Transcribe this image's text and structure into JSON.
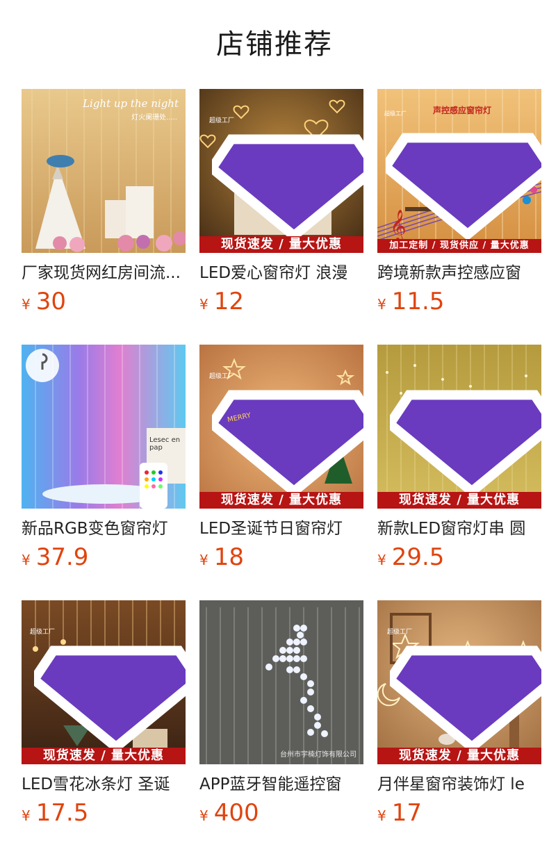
{
  "header": {
    "title": "店铺推荐"
  },
  "colors": {
    "price": "#e0440e",
    "banner": "#b71414"
  },
  "products": [
    {
      "name": "厂家现货网红房间流...",
      "currency": "¥",
      "price": "30",
      "banner": "",
      "overlay": "Light up the night",
      "overlay_sub": "灯火阑珊处....."
    },
    {
      "name": "LED爱心窗帘灯 浪漫",
      "currency": "¥",
      "price": "12",
      "banner": "现货速发 / 量大优惠",
      "badge_text": "超级工厂"
    },
    {
      "name": "跨境新款声控感应窗",
      "currency": "¥",
      "price": "11.5",
      "banner": "加工定制 / 现货供应 / 量大优惠",
      "badge_text": "超级工厂",
      "top_text": "声控感应窗帘灯"
    },
    {
      "name": "新品RGB变色窗帘灯",
      "currency": "¥",
      "price": "37.9",
      "banner": "",
      "overlay": "Lesec en pap"
    },
    {
      "name": "LED圣诞节日窗帘灯",
      "currency": "¥",
      "price": "18",
      "banner": "现货速发 / 量大优惠",
      "badge_text": "超级工厂",
      "overlay": "MERRY"
    },
    {
      "name": "新款LED窗帘灯串 圆",
      "currency": "¥",
      "price": "29.5",
      "banner": "现货速发 / 量大优惠"
    },
    {
      "name": "LED雪花冰条灯 圣诞",
      "currency": "¥",
      "price": "17.5",
      "banner": "现货速发 / 量大优惠",
      "badge_text": "超级工厂"
    },
    {
      "name": "APP蓝牙智能遥控窗",
      "currency": "¥",
      "price": "400",
      "banner": "",
      "overlay": "台州市宇楠灯饰有限公司"
    },
    {
      "name": "月伴星窗帘装饰灯 le",
      "currency": "¥",
      "price": "17",
      "banner": "现货速发 / 量大优惠",
      "badge_text": "超级工厂"
    }
  ]
}
